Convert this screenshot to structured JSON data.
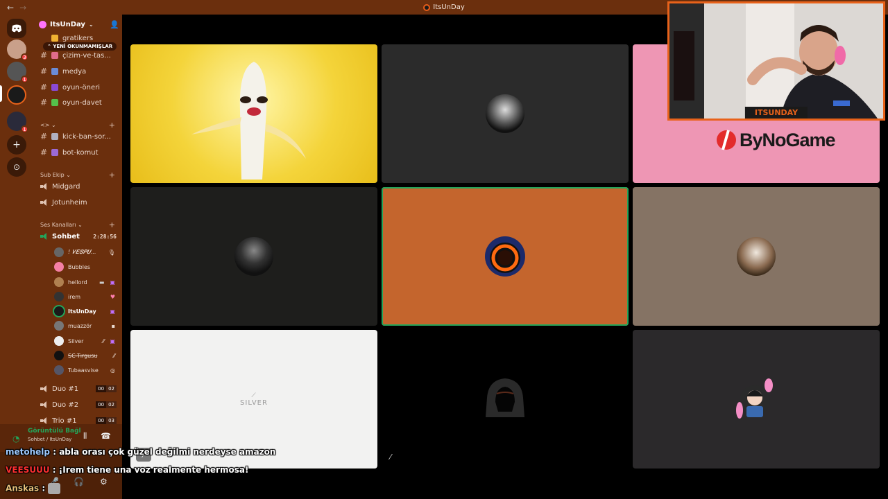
{
  "window": {
    "title": "ItsUnDay"
  },
  "server": {
    "name": "ItsUnDay",
    "unread_label": "YENİ OKUNMAMIŞLAR"
  },
  "channels_top": [
    {
      "name": "gratikers"
    },
    {
      "name": "çizim-ve-tas..."
    },
    {
      "name": "medya"
    },
    {
      "name": "oyun-öneri"
    },
    {
      "name": "oyun-davet"
    }
  ],
  "category_unnamed": {
    "label": "<>"
  },
  "channels_mod": [
    {
      "name": "kick-ban-sor..."
    },
    {
      "name": "bot-komut"
    }
  ],
  "category_sub": {
    "label": "Sub Ekip"
  },
  "voice_sub": [
    {
      "name": "Midgard"
    },
    {
      "name": "Jotunheim"
    }
  ],
  "category_ses": {
    "label": "Ses Kanalları"
  },
  "active_voice": {
    "name": "Sohbet",
    "timer": "2:28:56"
  },
  "voice_users": [
    {
      "name": "! 𝑽𝑬𝑺𝑷𝑼...",
      "icon": "mic-icon"
    },
    {
      "name": "Bubbles",
      "icon": ""
    },
    {
      "name": "hellord",
      "icon": "video-icon"
    },
    {
      "name": "irem",
      "icon": "heart-icon"
    },
    {
      "name": "ItsUnDay",
      "icon": "stream-icon"
    },
    {
      "name": "muazzör",
      "icon": "badge-icon"
    },
    {
      "name": "Silver",
      "icon": "mute-icon"
    },
    {
      "name": "SC-Tırgusu",
      "icon": "mute-icon"
    },
    {
      "name": "Tubaasvise",
      "icon": "badge-icon"
    }
  ],
  "duo_channels": [
    {
      "name": "Duo #1",
      "count": "00",
      "limit": "02"
    },
    {
      "name": "Duo #2",
      "count": "00",
      "limit": "02"
    },
    {
      "name": "Trio #1",
      "count": "00",
      "limit": "03"
    }
  ],
  "voice_panel": {
    "status": "Görüntülü Bağl",
    "sub": "Sohbet / ItsUnDay"
  },
  "tiles": [
    {
      "name": "banana-video"
    },
    {
      "name": "user-tile-2"
    },
    {
      "name": "bynogame-video",
      "text": "ByNoGame"
    },
    {
      "name": "user-tile-4"
    },
    {
      "name": "itsunday-tile"
    },
    {
      "name": "user-tile-6"
    },
    {
      "name": "silver-tile",
      "text": "SILVER"
    },
    {
      "name": "user-tile-8"
    },
    {
      "name": "user-tile-9"
    }
  ],
  "cam": {
    "label": "ITSUNDAY"
  },
  "chat": [
    {
      "user": "metohelp",
      "sep": ":",
      "msg": "abla orası çok güzel değilmi nerdeyse amazon",
      "color": "#9ec9ff"
    },
    {
      "user": "VEESUUU",
      "sep": ":",
      "msg": "¡Irem tiene una voz realmente hermosa!",
      "color": "#ff3030"
    },
    {
      "user": "Anskas",
      "sep": ":",
      "msg": "",
      "color": "#e8c07a"
    }
  ]
}
